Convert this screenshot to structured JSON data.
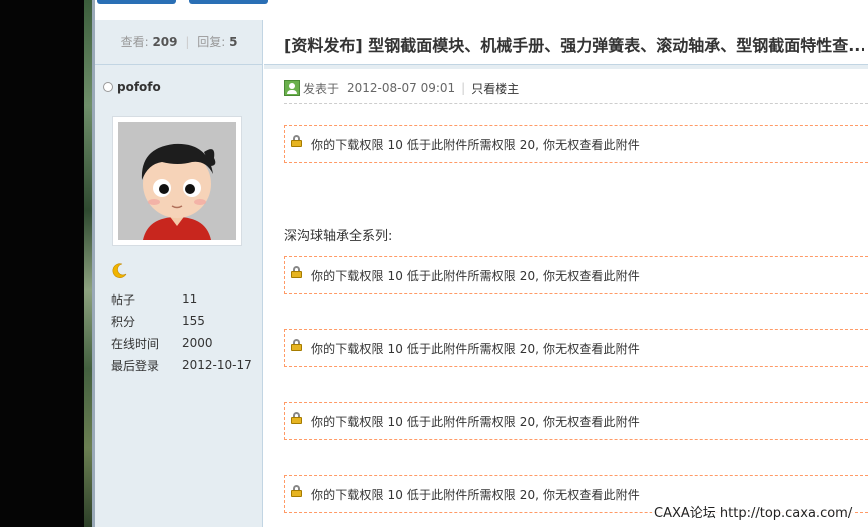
{
  "thread": {
    "views_label": "查看:",
    "views_value": "209",
    "replies_label": "回复:",
    "replies_value": "5",
    "title": "[资料发布] 型钢截面模块、机械手册、强力弹簧表、滚动轴承、型钢截面特性查..."
  },
  "author": {
    "username": "pofofo",
    "level_icon": "moon-icon",
    "stats": [
      {
        "label": "帖子",
        "value": "11"
      },
      {
        "label": "积分",
        "value": "155"
      },
      {
        "label": "在线时间",
        "value": "2000"
      },
      {
        "label": "最后登录",
        "value": "2012-10-17"
      }
    ]
  },
  "post": {
    "posted_prefix": "发表于",
    "posted_time": "2012-08-07 09:01",
    "only_author_link": "只看楼主",
    "section_text": "深沟球轴承全系列:",
    "locked_notices": [
      "你的下载权限  10 低于此附件所需权限  20, 你无权查看此附件",
      "你的下载权限  10 低于此附件所需权限  20, 你无权查看此附件",
      "你的下载权限  10 低于此附件所需权限  20, 你无权查看此附件",
      "你的下载权限  10 低于此附件所需权限  20, 你无权查看此附件",
      "你的下载权限  10 低于此附件所需权限  20, 你无权查看此附件"
    ]
  },
  "watermark": "CAXA论坛 http://top.caxa.com/",
  "colors": {
    "sidebar_bg": "#e5edf2",
    "border": "#c2d5e3",
    "locked_border": "#ff9a66",
    "nav_blue": "#2a6fb5"
  }
}
